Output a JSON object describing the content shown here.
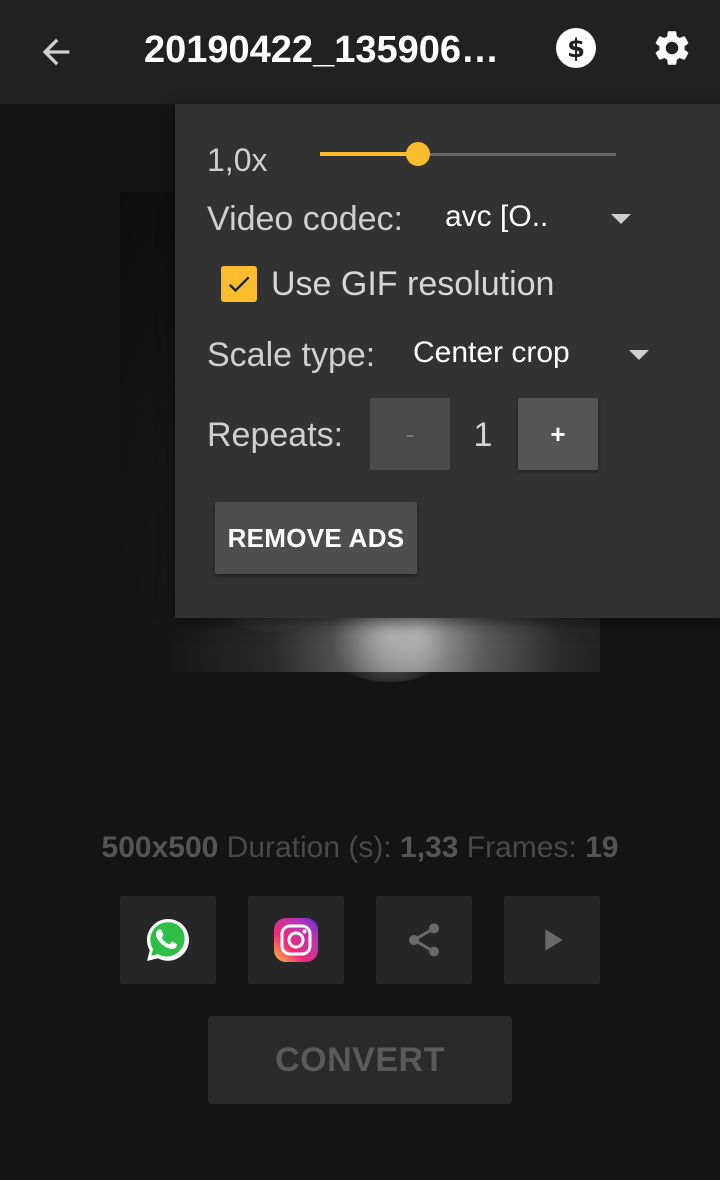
{
  "header": {
    "title": "20190422_135906…",
    "icons": [
      "arrow-left-icon",
      "dollar-coin-icon",
      "gear-icon"
    ]
  },
  "settings_panel": {
    "speed": {
      "label": "1,0x",
      "level_fraction": 0.33,
      "accent_color": "#fbbd2e"
    },
    "video_codec": {
      "label": "Video codec:",
      "selected": "avc [O.."
    },
    "gif_resolution": {
      "label": "Use GIF resolution",
      "checked": true
    },
    "scale_type": {
      "label": "Scale type:",
      "selected": "Center crop"
    },
    "repeats": {
      "label": "Repeats:",
      "minus_label": "-",
      "value": "1",
      "plus_label": "+"
    },
    "remove_ads_label": "REMOVE ADS"
  },
  "info": {
    "resolution": "500x500",
    "duration_label": " Duration (s): ",
    "duration_value": "1,33",
    "frames_label": " Frames: ",
    "frames_value": "19"
  },
  "share_buttons": {
    "icons": [
      "whatsapp-icon",
      "instagram-icon",
      "share-icon",
      "play-icon"
    ]
  },
  "convert_label": "CONVERT"
}
